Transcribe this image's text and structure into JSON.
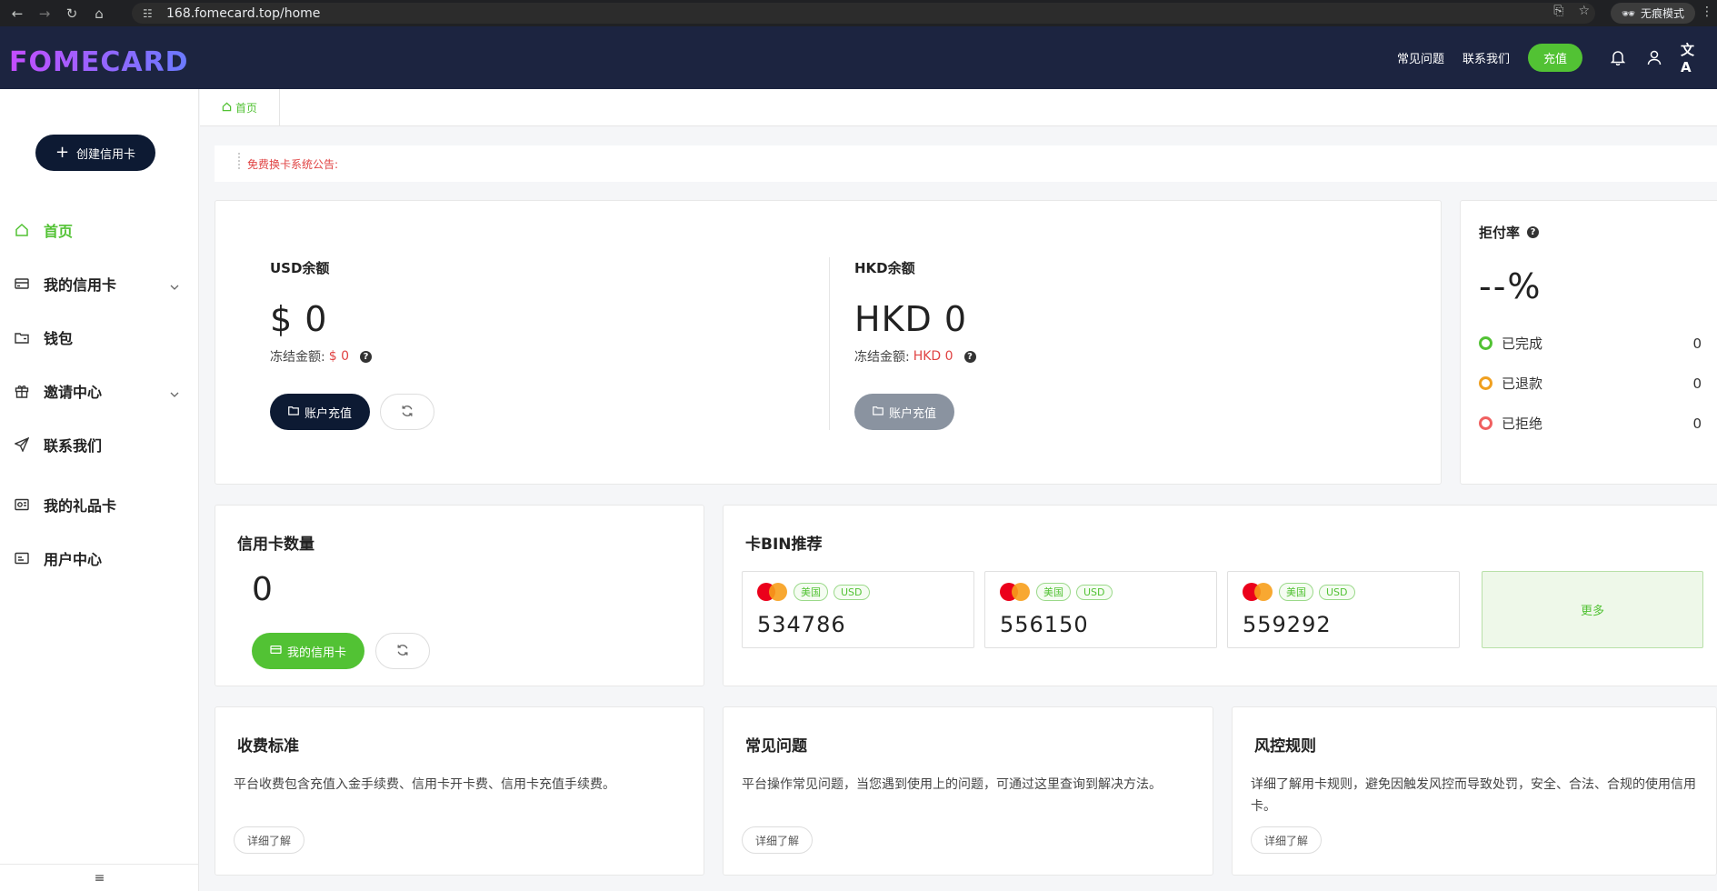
{
  "browser": {
    "url": "168.fomecard.top/home",
    "incognito_label": "无痕模式"
  },
  "header": {
    "logo": "FOMECARD",
    "faq": "常见问题",
    "contact": "联系我们",
    "recharge": "充值"
  },
  "sidebar": {
    "create_btn": "创建信用卡",
    "items": [
      {
        "label": "首页",
        "icon": "home-icon",
        "active": true
      },
      {
        "label": "我的信用卡",
        "icon": "card-icon",
        "expandable": true
      },
      {
        "label": "钱包",
        "icon": "wallet-icon"
      },
      {
        "label": "邀请中心",
        "icon": "gift-box-icon",
        "expandable": true
      },
      {
        "label": "联系我们",
        "icon": "send-icon"
      },
      {
        "label": "我的礼品卡",
        "icon": "giftcard-icon"
      },
      {
        "label": "用户中心",
        "icon": "user-card-icon"
      }
    ]
  },
  "tabs": {
    "home": "首页"
  },
  "notice": {
    "text": "免费换卡系统公告:"
  },
  "balance": {
    "usd": {
      "label": "USD余额",
      "amount": "$ 0",
      "frozen_label": "冻结金额:",
      "frozen_value": "$ 0",
      "recharge": "账户充值"
    },
    "hkd": {
      "label": "HKD余额",
      "amount": "HKD 0",
      "frozen_label": "冻结金额:",
      "frozen_value": "HKD 0",
      "recharge": "账户充值"
    }
  },
  "rejection": {
    "title": "拒付率",
    "percent": "--%",
    "rows": [
      {
        "label": "已完成",
        "value": "0",
        "color": "#52c234"
      },
      {
        "label": "已退款",
        "value": "0",
        "color": "#f0a020"
      },
      {
        "label": "已拒绝",
        "value": "0",
        "color": "#f06060"
      }
    ]
  },
  "card_count": {
    "title": "信用卡数量",
    "value": "0",
    "my_cards": "我的信用卡"
  },
  "bin": {
    "title": "卡BIN推荐",
    "items": [
      {
        "country": "美国",
        "currency": "USD",
        "bin": "534786"
      },
      {
        "country": "美国",
        "currency": "USD",
        "bin": "556150"
      },
      {
        "country": "美国",
        "currency": "USD",
        "bin": "559292"
      }
    ],
    "more": "更多"
  },
  "info": [
    {
      "title": "收费标准",
      "text": "平台收费包含充值入金手续费、信用卡开卡费、信用卡充值手续费。",
      "button": "详细了解"
    },
    {
      "title": "常见问题",
      "text": "平台操作常见问题，当您遇到使用上的问题，可通过这里查询到解决方法。",
      "button": "详细了解"
    },
    {
      "title": "风控规则",
      "text": "详细了解用卡规则，避免因触发风控而导致处罚，安全、合法、合规的使用信用卡。",
      "button": "详细了解"
    }
  ]
}
